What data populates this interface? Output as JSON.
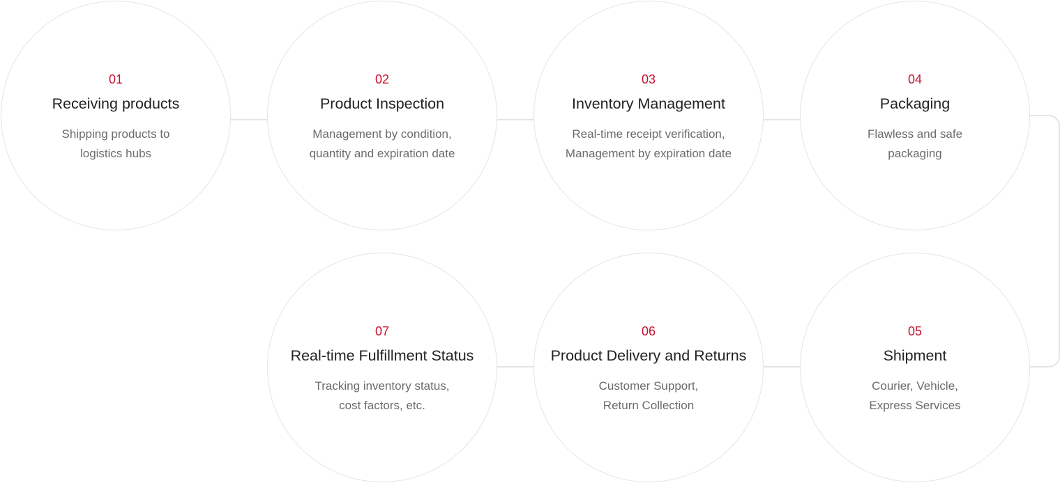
{
  "colors": {
    "accent": "#c8102e",
    "title": "#222222",
    "description": "#6b6b6b",
    "border": "#e4e4e4"
  },
  "steps": [
    {
      "number": "01",
      "title": "Receiving products",
      "description": [
        "Shipping products to",
        "logistics hubs"
      ]
    },
    {
      "number": "02",
      "title": "Product Inspection",
      "description": [
        "Management by condition,",
        "quantity and expiration date"
      ]
    },
    {
      "number": "03",
      "title": "Inventory Management",
      "description": [
        "Real-time receipt verification,",
        "Management by expiration date"
      ]
    },
    {
      "number": "04",
      "title": "Packaging",
      "description": [
        "Flawless and safe",
        "packaging"
      ]
    },
    {
      "number": "05",
      "title": "Shipment",
      "description": [
        "Courier, Vehicle,",
        "Express Services"
      ]
    },
    {
      "number": "06",
      "title": "Product Delivery and Returns",
      "description": [
        "Customer Support,",
        "Return Collection"
      ]
    },
    {
      "number": "07",
      "title": "Real-time Fulfillment Status",
      "description": [
        "Tracking inventory status,",
        "cost factors, etc."
      ]
    }
  ]
}
